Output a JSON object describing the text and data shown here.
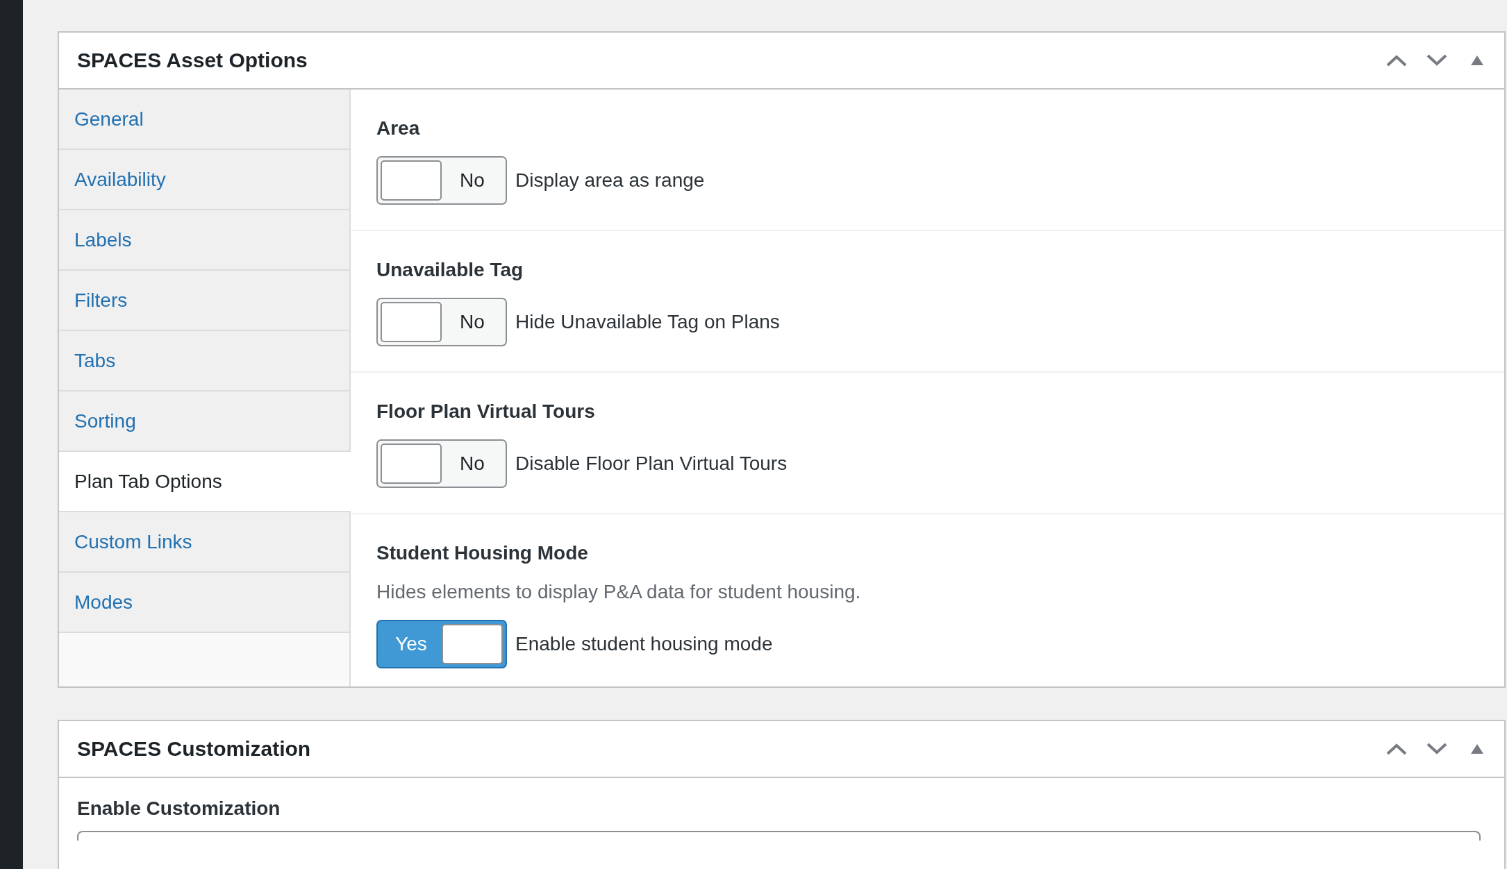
{
  "panels": [
    {
      "title": "SPACES Asset Options",
      "tabs": [
        {
          "label": "General",
          "selected": false
        },
        {
          "label": "Availability",
          "selected": false
        },
        {
          "label": "Labels",
          "selected": false
        },
        {
          "label": "Filters",
          "selected": false
        },
        {
          "label": "Tabs",
          "selected": false
        },
        {
          "label": "Sorting",
          "selected": false
        },
        {
          "label": "Plan Tab Options",
          "selected": true
        },
        {
          "label": "Custom Links",
          "selected": false
        },
        {
          "label": "Modes",
          "selected": false
        }
      ],
      "settings": [
        {
          "title": "Area",
          "toggle": {
            "on": false,
            "label": "No"
          },
          "caption": "Display area as range"
        },
        {
          "title": "Unavailable Tag",
          "toggle": {
            "on": false,
            "label": "No"
          },
          "caption": "Hide Unavailable Tag on Plans"
        },
        {
          "title": "Floor Plan Virtual Tours",
          "toggle": {
            "on": false,
            "label": "No"
          },
          "caption": "Disable Floor Plan Virtual Tours"
        },
        {
          "title": "Student Housing Mode",
          "description": "Hides elements to display P&A data for student housing.",
          "toggle": {
            "on": true,
            "label": "Yes"
          },
          "caption": "Enable student housing mode"
        }
      ]
    },
    {
      "title": "SPACES Customization",
      "field_label": "Enable Customization"
    }
  ]
}
